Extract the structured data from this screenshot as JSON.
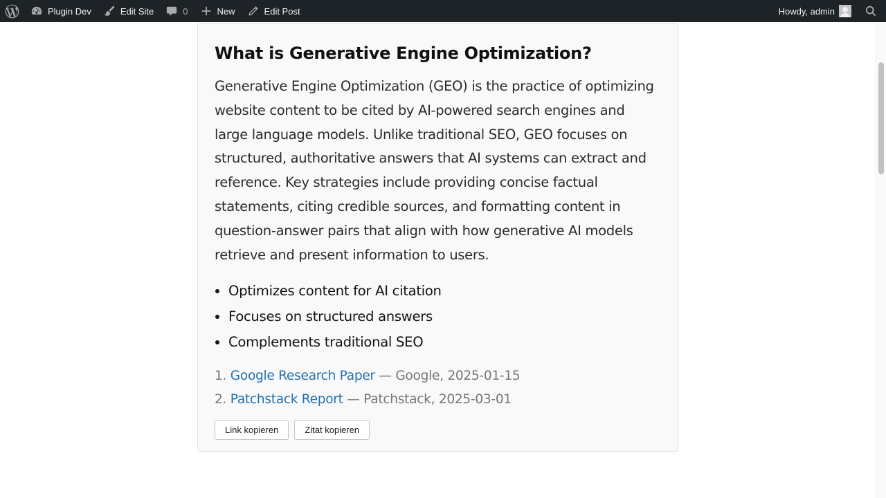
{
  "adminbar": {
    "site_name": "Plugin Dev",
    "edit_site": "Edit Site",
    "comments_count": "0",
    "new_label": "New",
    "edit_post": "Edit Post",
    "howdy": "Howdy, admin",
    "background_color": "#1d2327",
    "icons": {
      "wp": "wordpress-logo-icon",
      "site": "dashboard-icon",
      "edit_site": "brush-icon",
      "comments": "comment-icon",
      "new": "plus-icon",
      "edit_post": "pencil-icon",
      "search": "search-icon"
    }
  },
  "article": {
    "title": "What is Generative Engine Optimization?",
    "paragraph": "Generative Engine Optimization (GEO) is the practice of optimizing website content to be cited by AI-powered search engines and large language models. Unlike traditional SEO, GEO focuses on structured, authoritative answers that AI systems can extract and reference. Key strategies include providing concise factual statements, citing credible sources, and formatting content in question-answer pairs that align with how generative AI models retrieve and present information to users.",
    "bullets": [
      "Optimizes content for AI citation",
      "Focuses on structured answers",
      "Complements traditional SEO"
    ],
    "sources": [
      {
        "num": "1.",
        "title": "Google Research Paper",
        "meta": " — Google, 2025-01-15"
      },
      {
        "num": "2.",
        "title": "Patchstack Report",
        "meta": " — Patchstack, 2025-03-01"
      }
    ],
    "link_color": "#2271b1",
    "buttons": {
      "copy_link": "Link kopieren",
      "copy_quote": "Zitat kopieren"
    }
  }
}
